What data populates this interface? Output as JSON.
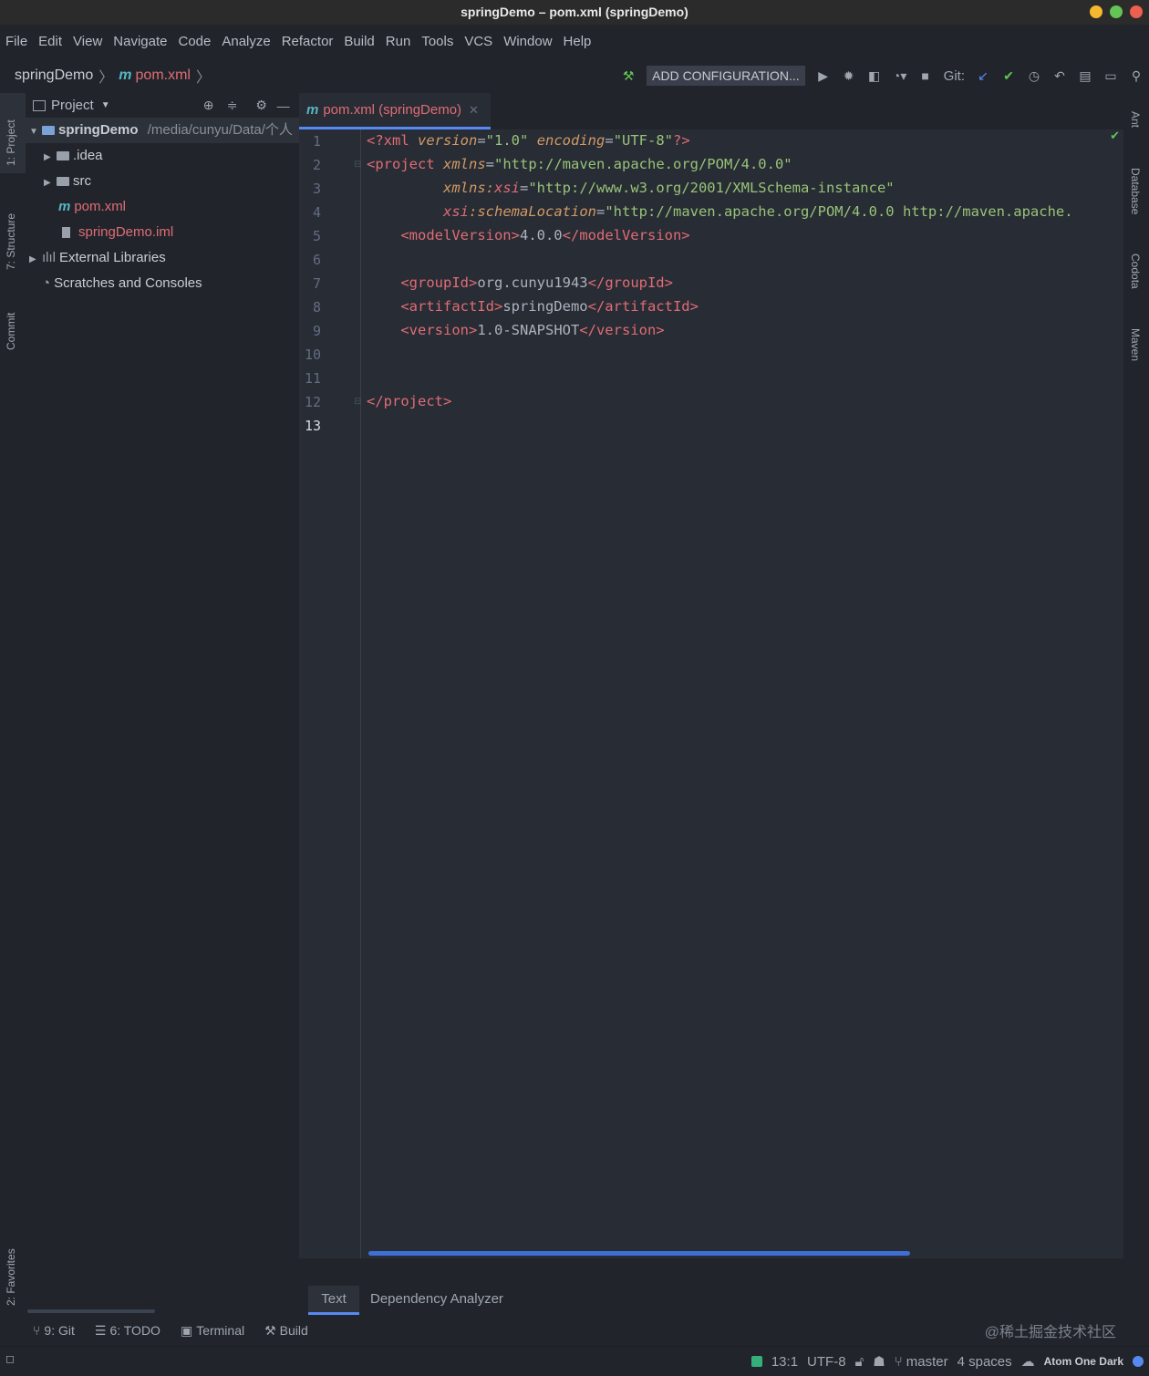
{
  "window": {
    "title": "springDemo – pom.xml (springDemo)"
  },
  "menu": [
    "File",
    "Edit",
    "View",
    "Navigate",
    "Code",
    "Analyze",
    "Refactor",
    "Build",
    "Run",
    "Tools",
    "VCS",
    "Window",
    "Help"
  ],
  "breadcrumb": {
    "project": "springDemo",
    "file": "pom.xml"
  },
  "toolbar": {
    "add_configuration": "ADD CONFIGURATION...",
    "git_label": "Git:"
  },
  "left_strip": {
    "project": "1: Project",
    "structure": "7: Structure",
    "commit": "Commit",
    "favorites": "2: Favorites"
  },
  "project_panel": {
    "title": "Project",
    "root_name": "springDemo",
    "root_path": "/media/cunyu/Data/个人",
    "items": [
      ".idea",
      "src",
      "pom.xml",
      "springDemo.iml",
      "External Libraries",
      "Scratches and Consoles"
    ]
  },
  "editor": {
    "tab_label": "pom.xml (springDemo)",
    "line_numbers": [
      "1",
      "2",
      "3",
      "4",
      "5",
      "6",
      "7",
      "8",
      "9",
      "10",
      "11",
      "12",
      "13"
    ],
    "current_line": "13",
    "lines": [
      "<?xml version=\"1.0\" encoding=\"UTF-8\"?>",
      "<project xmlns=\"http://maven.apache.org/POM/4.0.0\"",
      "         xmlns:xsi=\"http://www.w3.org/2001/XMLSchema-instance\"",
      "         xsi:schemaLocation=\"http://maven.apache.org/POM/4.0.0 http://maven.apache.",
      "    <modelVersion>4.0.0</modelVersion>",
      "",
      "    <groupId>org.cunyu1943</groupId>",
      "    <artifactId>springDemo</artifactId>",
      "    <version>1.0-SNAPSHOT</version>",
      "",
      "",
      "</project>",
      ""
    ],
    "bottom_tabs": [
      "Text",
      "Dependency Analyzer"
    ]
  },
  "right_strip": [
    "Ant",
    "Database",
    "Codota",
    "Maven"
  ],
  "tool_windows": [
    "9: Git",
    "6: TODO",
    "Terminal",
    "Build"
  ],
  "watermark": "@稀土掘金技术社区",
  "status": {
    "position": "13:1",
    "encoding": "UTF-8",
    "branch": "master",
    "indent": "4 spaces",
    "theme": "Atom One Dark"
  },
  "colors": {
    "accent": "#568af2",
    "background": "#282c34",
    "panel": "#21252b",
    "tag": "#e06c75",
    "attribute": "#d19a66",
    "string": "#98c379"
  }
}
